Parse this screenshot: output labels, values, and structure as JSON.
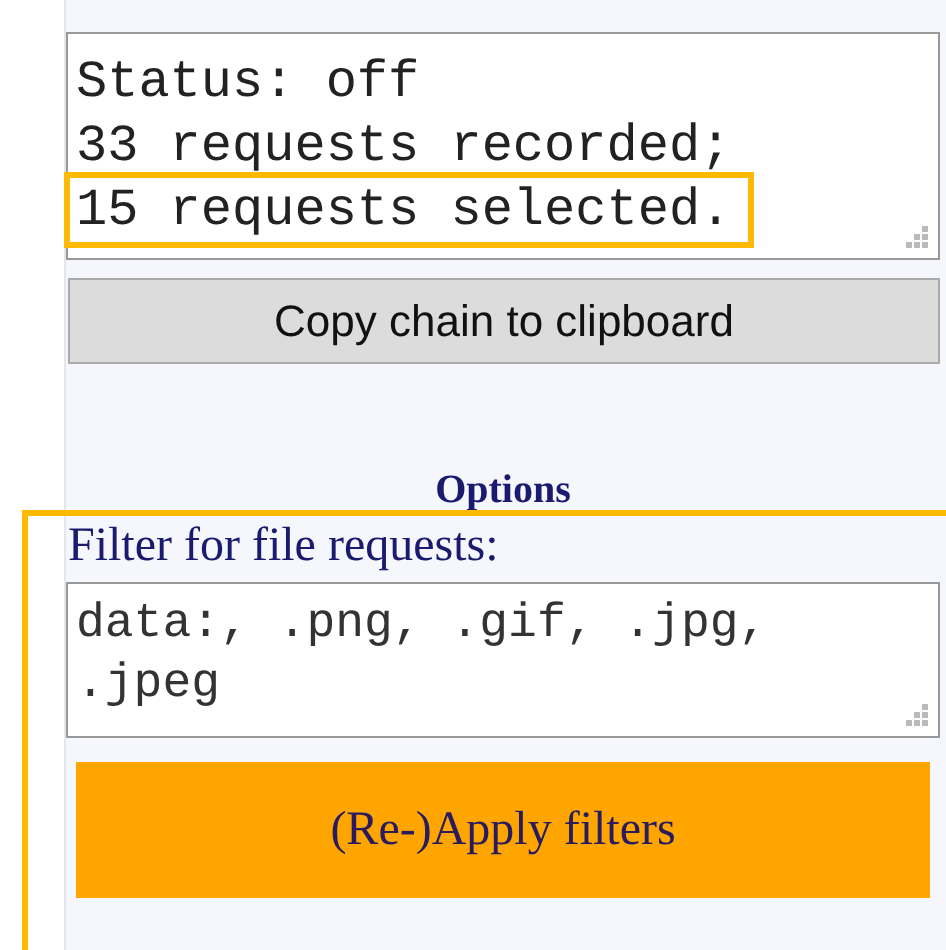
{
  "status_box": {
    "lines": [
      {
        "text": "Status: off",
        "highlighted": false
      },
      {
        "text": "33 requests recorded;",
        "highlighted": false
      },
      {
        "text": "15 requests selected.",
        "highlighted": true
      }
    ]
  },
  "copy_button": {
    "label": "Copy chain to clipboard"
  },
  "options": {
    "heading": "Options",
    "highlighted": true,
    "filter_label": "Filter for file requests:",
    "filter_value": "data:, .png, .gif, .jpg, .jpeg",
    "apply_button": "(Re-)Apply filters"
  }
}
